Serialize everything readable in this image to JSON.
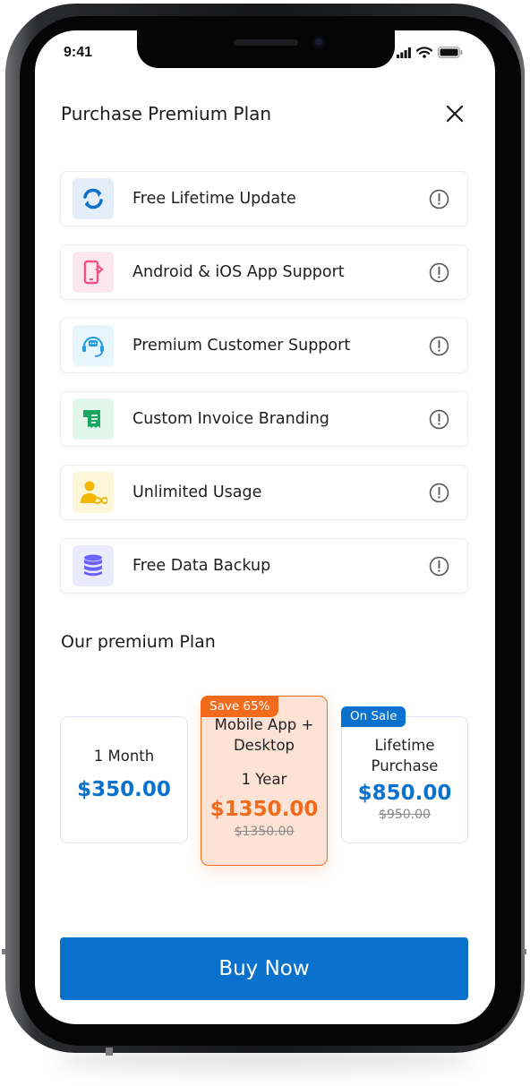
{
  "status_bar": {
    "time": "9:41"
  },
  "header": {
    "title": "Purchase Premium Plan",
    "close_icon": "close-icon"
  },
  "features": [
    {
      "label": "Free Lifetime Update",
      "icon": "refresh-icon",
      "icon_color": "#0a72cc",
      "icon_bg": "#e4eef8"
    },
    {
      "label": "Android & iOS App Support",
      "icon": "mobile-settings-icon",
      "icon_color": "#f0508a",
      "icon_bg": "#fde7ef"
    },
    {
      "label": "Premium Customer Support",
      "icon": "headset-icon",
      "icon_color": "#1f9be0",
      "icon_bg": "#e7f5fc"
    },
    {
      "label": "Custom Invoice Branding",
      "icon": "invoice-icon",
      "icon_color": "#17a862",
      "icon_bg": "#e3f6ec"
    },
    {
      "label": "Unlimited Usage",
      "icon": "user-infinity-icon",
      "icon_color": "#f2b705",
      "icon_bg": "#fdf6d8"
    },
    {
      "label": "Free Data Backup",
      "icon": "database-icon",
      "icon_color": "#6c63ff",
      "icon_bg": "#ecebfd"
    }
  ],
  "section_title": "Our premium Plan",
  "plans": {
    "month": {
      "name": "1 Month",
      "price": "$350.00"
    },
    "year": {
      "badge": "Save 65%",
      "name_line1": "Mobile App +",
      "name_line2": "Desktop",
      "duration": "1 Year",
      "price": "$1350.00",
      "old_price": "$1350.00"
    },
    "lifetime": {
      "badge": "On Sale",
      "name_line1": "Lifetime",
      "name_line2": "Purchase",
      "price": "$850.00",
      "old_price": "$950.00"
    }
  },
  "buy_button": {
    "label": "Buy Now"
  },
  "colors": {
    "primary": "#0a72cc",
    "accent": "#f26a1b",
    "year_card_bg": "#fde3d6"
  }
}
